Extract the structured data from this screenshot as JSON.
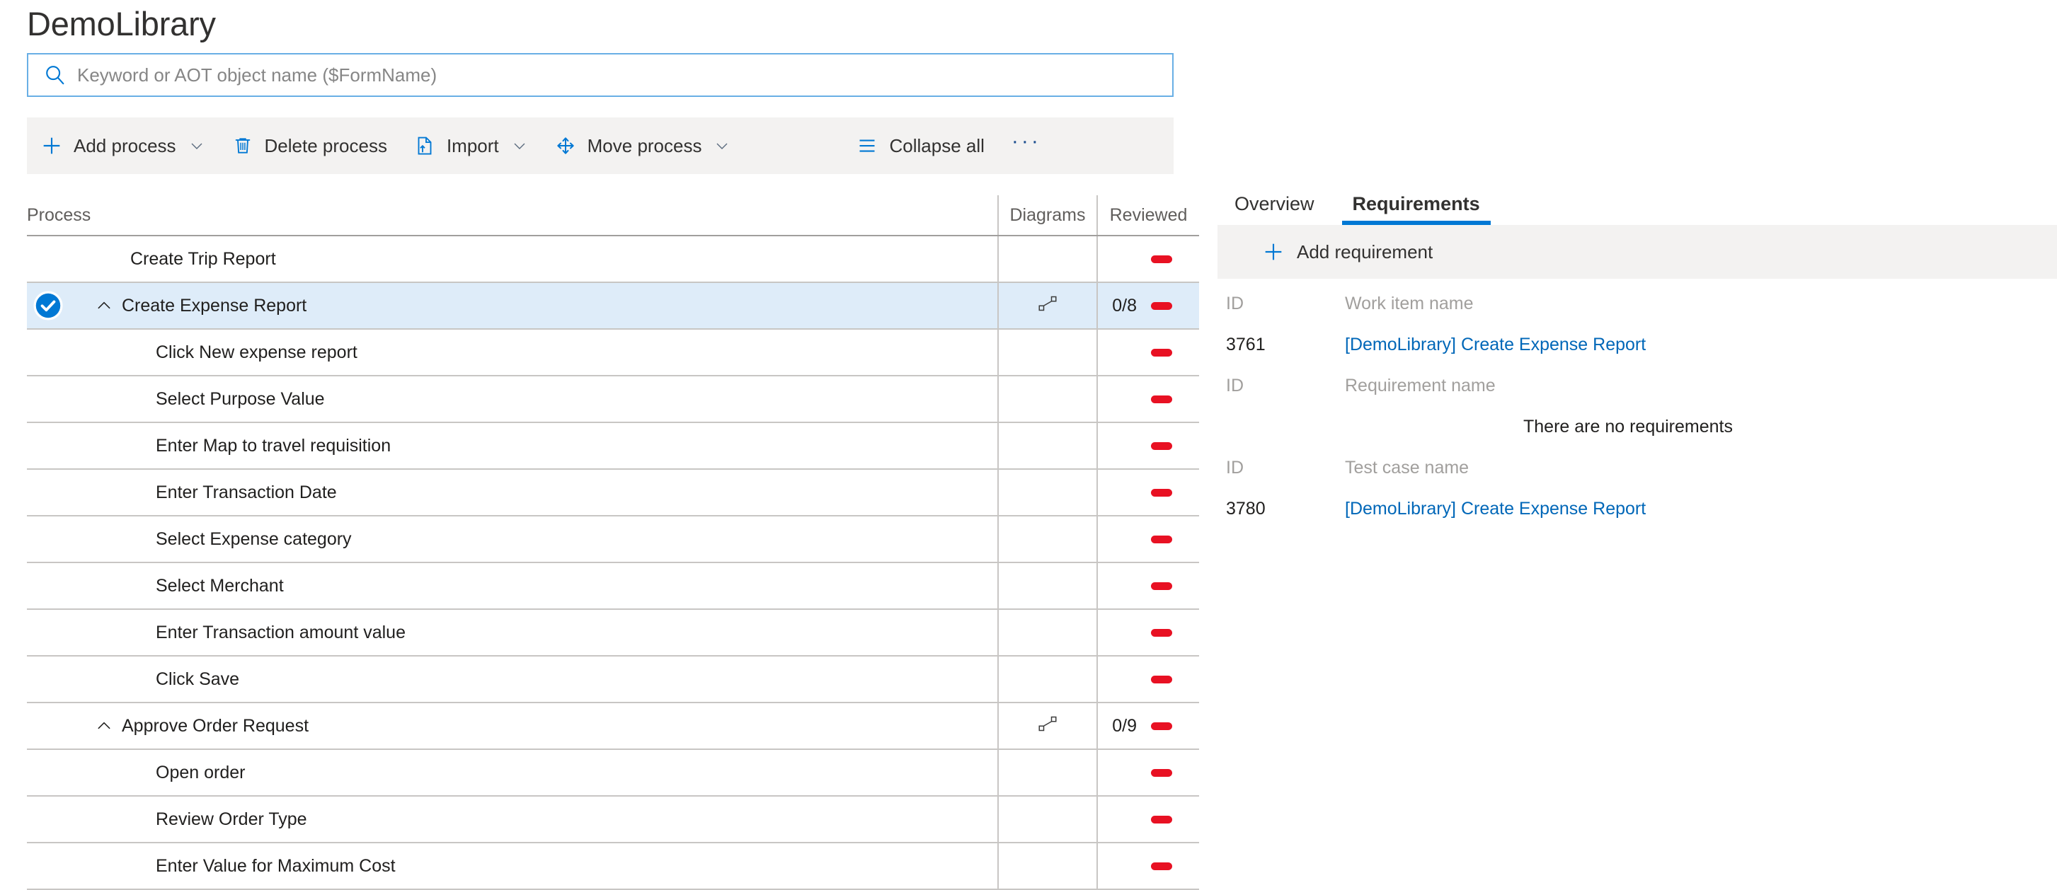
{
  "page": {
    "title": "DemoLibrary"
  },
  "search": {
    "placeholder": "Keyword or AOT object name ($FormName)",
    "value": "",
    "icon": "search-icon"
  },
  "command_bar": {
    "items": [
      {
        "label": "Add process",
        "icon": "plus-icon",
        "has_chevron": true
      },
      {
        "label": "Delete process",
        "icon": "trash-icon",
        "has_chevron": false
      },
      {
        "label": "Import",
        "icon": "import-page-icon",
        "has_chevron": true
      },
      {
        "label": "Move process",
        "icon": "move-arrows-icon",
        "has_chevron": true
      },
      {
        "label": "Collapse all",
        "icon": "hamburger-lines-icon",
        "has_chevron": false
      }
    ],
    "overflow_label": "···"
  },
  "process_table": {
    "columns": [
      "Process",
      "Diagrams",
      "Reviewed"
    ],
    "rows": [
      {
        "name": "Create Trip Report",
        "level": 0,
        "expander": false,
        "selected": false,
        "diagram": false,
        "reviewed_count": "",
        "reviewed_flag": true
      },
      {
        "name": "Create Expense Report",
        "level": 0,
        "expander": true,
        "selected": true,
        "diagram": true,
        "reviewed_count": "0/8",
        "reviewed_flag": true
      },
      {
        "name": "Click New expense report",
        "level": 1,
        "expander": false,
        "selected": false,
        "diagram": false,
        "reviewed_count": "",
        "reviewed_flag": true
      },
      {
        "name": "Select Purpose Value",
        "level": 1,
        "expander": false,
        "selected": false,
        "diagram": false,
        "reviewed_count": "",
        "reviewed_flag": true
      },
      {
        "name": "Enter Map to travel requisition",
        "level": 1,
        "expander": false,
        "selected": false,
        "diagram": false,
        "reviewed_count": "",
        "reviewed_flag": true
      },
      {
        "name": "Enter Transaction Date",
        "level": 1,
        "expander": false,
        "selected": false,
        "diagram": false,
        "reviewed_count": "",
        "reviewed_flag": true
      },
      {
        "name": "Select Expense category",
        "level": 1,
        "expander": false,
        "selected": false,
        "diagram": false,
        "reviewed_count": "",
        "reviewed_flag": true
      },
      {
        "name": "Select Merchant",
        "level": 1,
        "expander": false,
        "selected": false,
        "diagram": false,
        "reviewed_count": "",
        "reviewed_flag": true
      },
      {
        "name": "Enter Transaction amount value",
        "level": 1,
        "expander": false,
        "selected": false,
        "diagram": false,
        "reviewed_count": "",
        "reviewed_flag": true
      },
      {
        "name": "Click Save",
        "level": 1,
        "expander": false,
        "selected": false,
        "diagram": false,
        "reviewed_count": "",
        "reviewed_flag": true
      },
      {
        "name": "Approve Order Request",
        "level": 0,
        "expander": true,
        "selected": false,
        "diagram": true,
        "reviewed_count": "0/9",
        "reviewed_flag": true
      },
      {
        "name": "Open order",
        "level": 1,
        "expander": false,
        "selected": false,
        "diagram": false,
        "reviewed_count": "",
        "reviewed_flag": true
      },
      {
        "name": "Review Order Type",
        "level": 1,
        "expander": false,
        "selected": false,
        "diagram": false,
        "reviewed_count": "",
        "reviewed_flag": true
      },
      {
        "name": "Enter Value for Maximum Cost",
        "level": 1,
        "expander": false,
        "selected": false,
        "diagram": false,
        "reviewed_count": "",
        "reviewed_flag": true
      }
    ]
  },
  "detail_panel": {
    "tabs": [
      {
        "label": "Overview",
        "active": false
      },
      {
        "label": "Requirements",
        "active": true
      }
    ],
    "command": {
      "label": "Add requirement",
      "icon": "plus-icon"
    },
    "sections": [
      {
        "id_header": "ID",
        "name_header": "Work item name",
        "rows": [
          {
            "id": "3761",
            "name": "[DemoLibrary] Create Expense Report"
          }
        ],
        "empty_text": ""
      },
      {
        "id_header": "ID",
        "name_header": "Requirement name",
        "rows": [],
        "empty_text": "There are no requirements"
      },
      {
        "id_header": "ID",
        "name_header": "Test case name",
        "rows": [
          {
            "id": "3780",
            "name": "[DemoLibrary] Create Expense Report"
          }
        ],
        "empty_text": ""
      }
    ]
  },
  "colors": {
    "accent": "#0078d4",
    "link": "#0067b8",
    "selection_bg": "#deecf9",
    "status_red": "#e81123",
    "command_bar_bg": "#f3f2f1"
  }
}
